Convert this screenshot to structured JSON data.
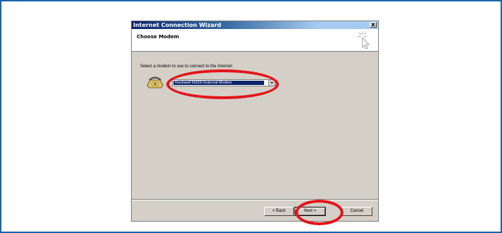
{
  "window": {
    "title": "Internet Connection Wizard",
    "close_label": "x"
  },
  "header": {
    "title": "Choose Modem",
    "icon": "wizard-cursor-icon"
  },
  "body": {
    "prompt": "Select a modem to use to connect to the Internet:",
    "modem_select": {
      "selected": "Rockwell 56000 External Modem",
      "icon": "modem-phone-icon"
    }
  },
  "buttons": {
    "back": "< Back",
    "next": "Next >",
    "cancel": "Cancel"
  },
  "colors": {
    "frame_border": "#1a64a8",
    "highlight": "#e3141b",
    "title_gradient_start": "#0a246a",
    "selection": "#0a246a"
  }
}
